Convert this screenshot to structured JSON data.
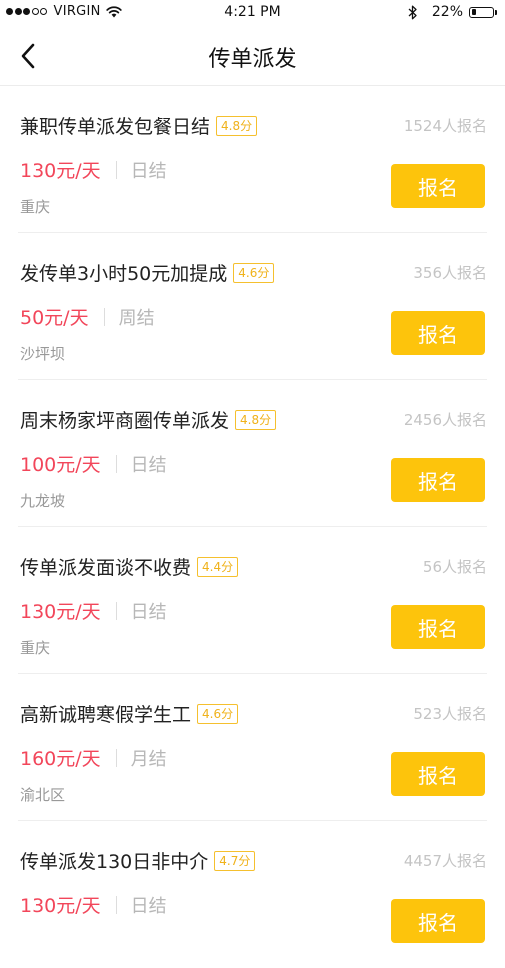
{
  "status_bar": {
    "carrier": "VIRGIN",
    "time": "4:21  PM",
    "battery_percent": "22%",
    "battery_level": 0.22,
    "signal_bars_filled": 3,
    "signal_bars_total": 5
  },
  "nav": {
    "title": "传单派发"
  },
  "jobs": [
    {
      "title": "兼职传单派发包餐日结",
      "rating": "4.8分",
      "signups": "1524人报名",
      "salary": "130元/天",
      "settlement": "日结",
      "location": "重庆",
      "apply_label": "报名"
    },
    {
      "title": "发传单3小时50元加提成",
      "rating": "4.6分",
      "signups": "356人报名",
      "salary": "50元/天",
      "settlement": "周结",
      "location": "沙坪坝",
      "apply_label": "报名"
    },
    {
      "title": "周末杨家坪商圈传单派发",
      "rating": "4.8分",
      "signups": "2456人报名",
      "salary": "100元/天",
      "settlement": "日结",
      "location": "九龙坡",
      "apply_label": "报名"
    },
    {
      "title": "传单派发面谈不收费",
      "rating": "4.4分",
      "signups": "56人报名",
      "salary": "130元/天",
      "settlement": "日结",
      "location": "重庆",
      "apply_label": "报名"
    },
    {
      "title": "高新诚聘寒假学生工",
      "rating": "4.6分",
      "signups": "523人报名",
      "salary": "160元/天",
      "settlement": "月结",
      "location": "渝北区",
      "apply_label": "报名"
    },
    {
      "title": "传单派发130日非中介",
      "rating": "4.7分",
      "signups": "4457人报名",
      "salary": "130元/天",
      "settlement": "日结",
      "location": "",
      "apply_label": "报名"
    }
  ],
  "colors": {
    "accent": "#fdc40c",
    "salary": "#f2465a",
    "rating": "#f0b21a"
  },
  "icons": {
    "back": "chevron-left-icon",
    "wifi": "wifi-icon",
    "bluetooth": "bluetooth-icon",
    "battery": "battery-icon"
  }
}
